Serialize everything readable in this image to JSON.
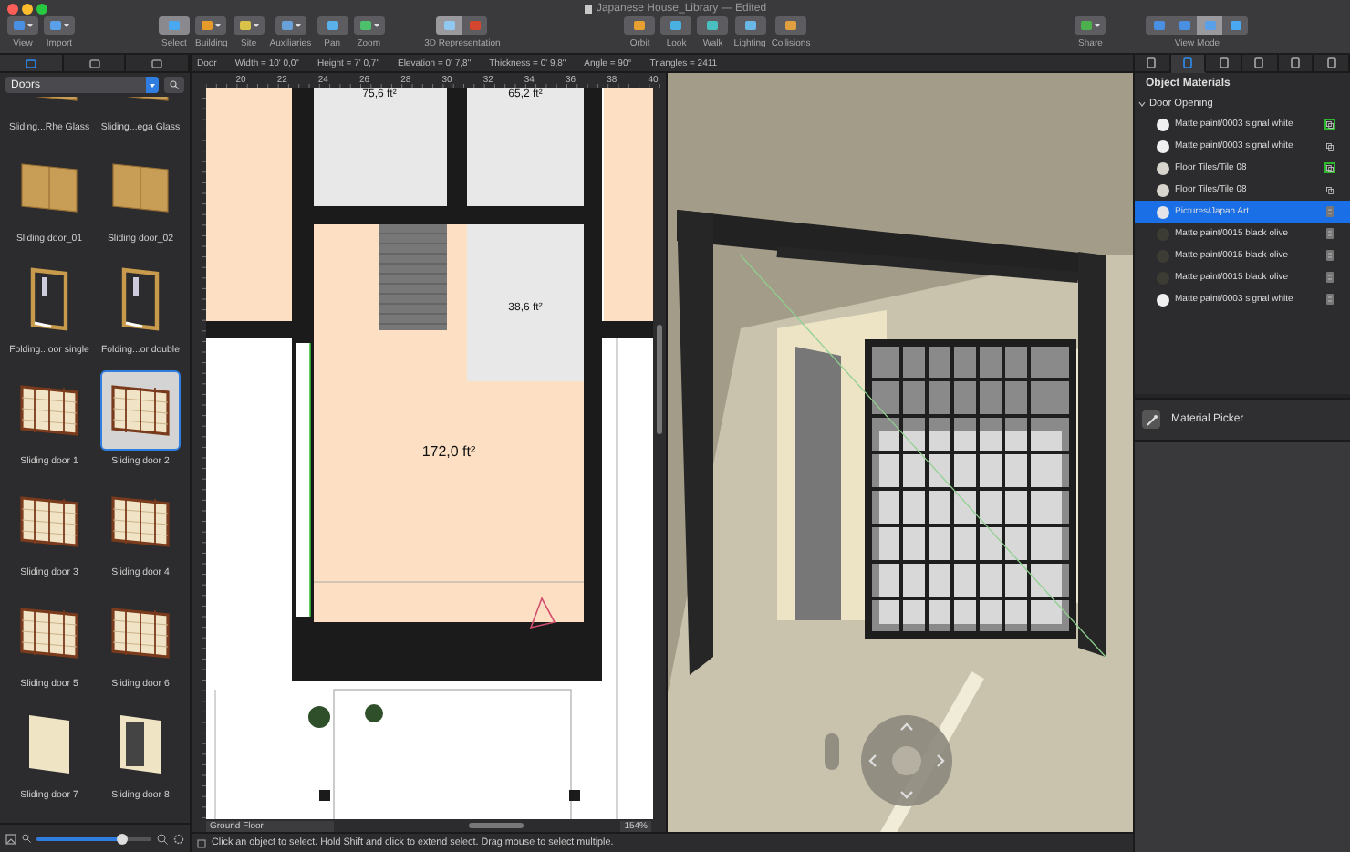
{
  "window": {
    "title": "Japanese House_Library — Edited"
  },
  "toolbar": {
    "groups": [
      {
        "items": [
          {
            "label": "View",
            "kind": "menu",
            "selected": false
          },
          {
            "label": "Import",
            "kind": "menu",
            "selected": false
          }
        ]
      },
      {
        "items": [
          {
            "label": "Select",
            "kind": "button",
            "selected": true
          },
          {
            "label": "Building",
            "kind": "menu",
            "selected": false
          },
          {
            "label": "Site",
            "kind": "menu",
            "selected": false
          },
          {
            "label": "Auxiliaries",
            "kind": "menu",
            "selected": false
          },
          {
            "label": "Pan",
            "kind": "button",
            "selected": false
          },
          {
            "label": "Zoom",
            "kind": "menu",
            "selected": false
          }
        ]
      },
      {
        "items": [
          {
            "label": "3D Representation",
            "kind": "segmented",
            "segments": [
              {
                "selected": true
              },
              {
                "selected": false
              }
            ]
          }
        ]
      },
      {
        "items": [
          {
            "label": "Orbit",
            "kind": "button",
            "selected": false
          },
          {
            "label": "Look",
            "kind": "button",
            "selected": false
          },
          {
            "label": "Walk",
            "kind": "button",
            "selected": false
          },
          {
            "label": "Lighting",
            "kind": "button",
            "selected": false
          },
          {
            "label": "Collisions",
            "kind": "button",
            "selected": false
          }
        ]
      },
      {
        "items": [
          {
            "label": "Share",
            "kind": "menu",
            "selected": false
          }
        ]
      },
      {
        "items": [
          {
            "label": "View Mode",
            "kind": "segmented",
            "segments": [
              {
                "selected": false
              },
              {
                "selected": false
              },
              {
                "selected": true
              },
              {
                "selected": false
              }
            ]
          }
        ]
      }
    ]
  },
  "sidebar": {
    "tabs": [
      {
        "selected": true
      },
      {
        "selected": false
      },
      {
        "selected": false
      }
    ],
    "category": "Doors",
    "items": [
      {
        "label": "Sliding...Rhe Glass",
        "kind": "panel",
        "selected": false
      },
      {
        "label": "Sliding...ega Glass",
        "kind": "panel",
        "selected": false
      },
      {
        "label": "Sliding door_01",
        "kind": "panel",
        "selected": false
      },
      {
        "label": "Sliding door_02",
        "kind": "panel",
        "selected": false
      },
      {
        "label": "Folding...oor single",
        "kind": "folding",
        "selected": false
      },
      {
        "label": "Folding...or double",
        "kind": "folding",
        "selected": false
      },
      {
        "label": "Sliding door 1",
        "kind": "shoji",
        "selected": false
      },
      {
        "label": "Sliding door 2",
        "kind": "shoji",
        "selected": true
      },
      {
        "label": "Sliding door 3",
        "kind": "shoji",
        "selected": false
      },
      {
        "label": "Sliding door 4",
        "kind": "shoji",
        "selected": false
      },
      {
        "label": "Sliding door 5",
        "kind": "shoji",
        "selected": false
      },
      {
        "label": "Sliding door 6",
        "kind": "shoji",
        "selected": false
      },
      {
        "label": "Sliding door 7",
        "kind": "plain",
        "selected": false
      },
      {
        "label": "Sliding door 8",
        "kind": "open",
        "selected": false
      }
    ],
    "zoom_slider": {
      "level": 0.75
    }
  },
  "info_bar": [
    "Door",
    "Width = 10' 0,0\"",
    "Height = 7' 0,7\"",
    "Elevation = 0' 7,8\"",
    "Thickness = 0' 9,8\"",
    "Angle = 90°",
    "Triangles = 2411"
  ],
  "plan": {
    "ruler_labels": [
      "20",
      "22",
      "24",
      "26",
      "28",
      "30",
      "32",
      "34",
      "36",
      "38",
      "40"
    ],
    "areas": [
      "75,6 ft²",
      "65,2 ft²",
      "38,6 ft²",
      "172,0 ft²"
    ],
    "floor": "Ground Floor",
    "zoom": "154%"
  },
  "materials": {
    "title": "Object Materials",
    "tabs": [
      {
        "selected": false
      },
      {
        "selected": true
      },
      {
        "selected": false
      },
      {
        "selected": false
      },
      {
        "selected": false
      },
      {
        "selected": false
      }
    ],
    "group": {
      "label": "Door Opening",
      "expanded": true,
      "items": [
        {
          "name": "Matte paint/0003 signal white",
          "color": "#f0f0f0",
          "kind": "copy",
          "linked": true,
          "selected": false
        },
        {
          "name": "Matte paint/0003 signal white",
          "color": "#f0f0f0",
          "kind": "copy",
          "linked": false,
          "selected": false
        },
        {
          "name": "Floor Tiles/Tile 08",
          "color": "#d6d4cc",
          "kind": "copy",
          "linked": true,
          "selected": false
        },
        {
          "name": "Floor Tiles/Tile 08",
          "color": "#d6d4cc",
          "kind": "copy",
          "linked": false,
          "selected": false
        },
        {
          "name": "Pictures/Japan Art",
          "color": "#e4e4e8",
          "kind": "stack",
          "linked": false,
          "selected": true
        },
        {
          "name": "Matte paint/0015 black olive",
          "color": "#3d3c34",
          "kind": "stack",
          "linked": false,
          "selected": false
        },
        {
          "name": "Matte paint/0015 black olive",
          "color": "#3d3c34",
          "kind": "stack",
          "linked": false,
          "selected": false
        },
        {
          "name": "Matte paint/0015 black olive",
          "color": "#3d3c34",
          "kind": "stack",
          "linked": false,
          "selected": false
        },
        {
          "name": "Matte paint/0003 signal white",
          "color": "#f0f0f0",
          "kind": "stack",
          "linked": false,
          "selected": false
        }
      ]
    },
    "picker": "Material Picker"
  },
  "status_bar": {
    "text": "Click an object to select. Hold Shift and click to extend select. Drag mouse to select multiple."
  }
}
